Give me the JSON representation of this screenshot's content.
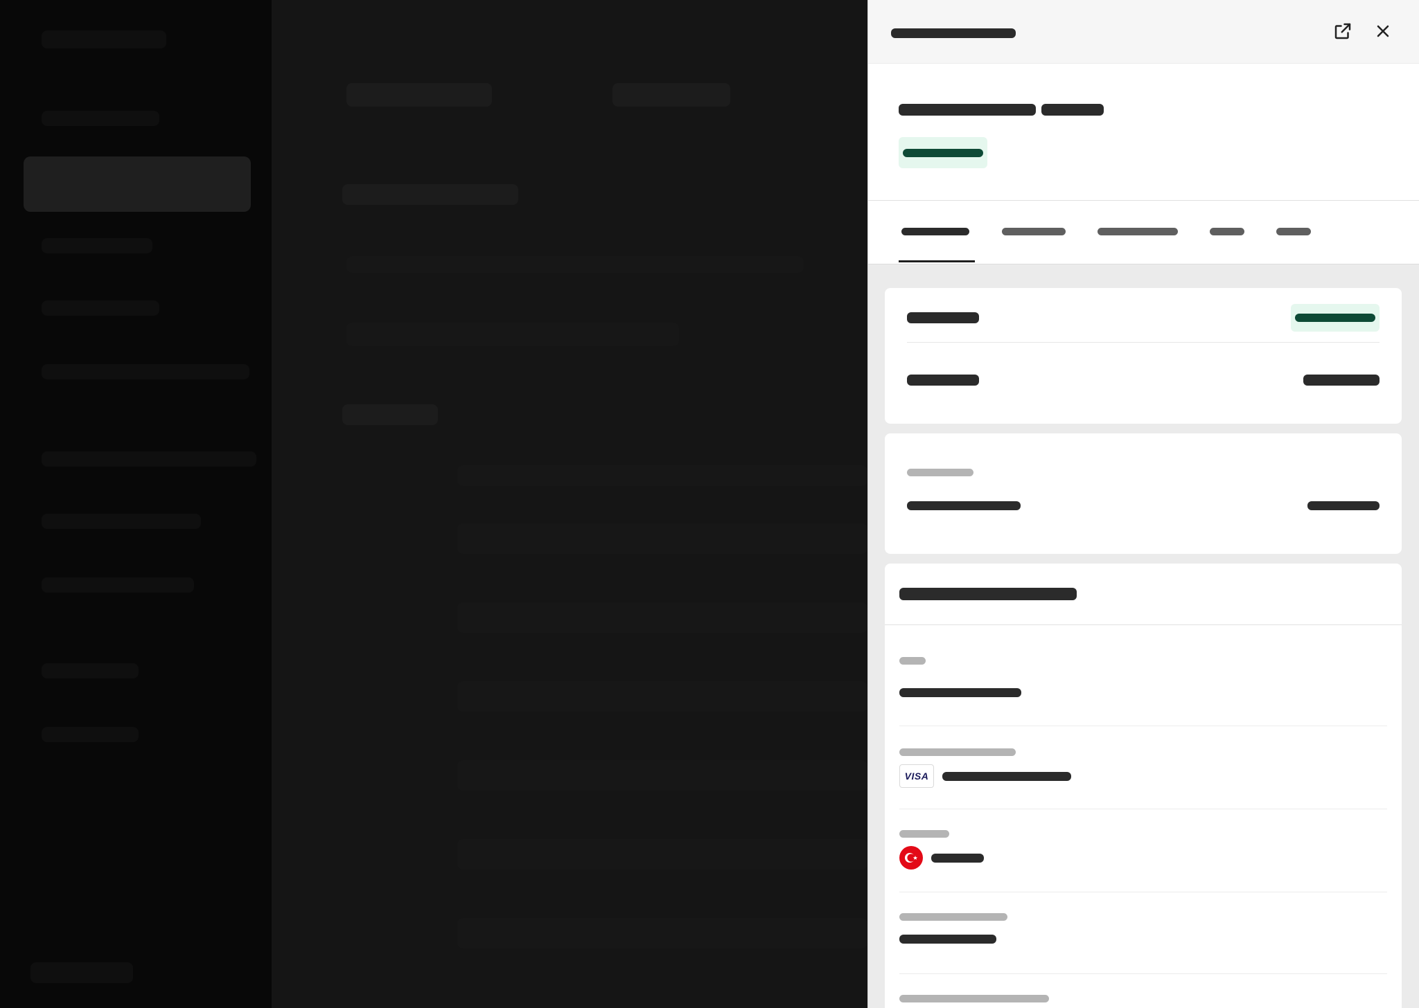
{
  "drawer": {
    "open_external_icon": "external-link-icon",
    "close_icon": "close-icon",
    "colors": {
      "accent_green": "#0e4a36",
      "pill_bg": "#e5f7ee",
      "visa_blue": "#1a1a5a",
      "flag_red": "#e30a17"
    }
  },
  "details": {
    "payment_method": {
      "brand": "VISA"
    },
    "country": {
      "flag_icon": "turkey-flag-icon"
    }
  }
}
